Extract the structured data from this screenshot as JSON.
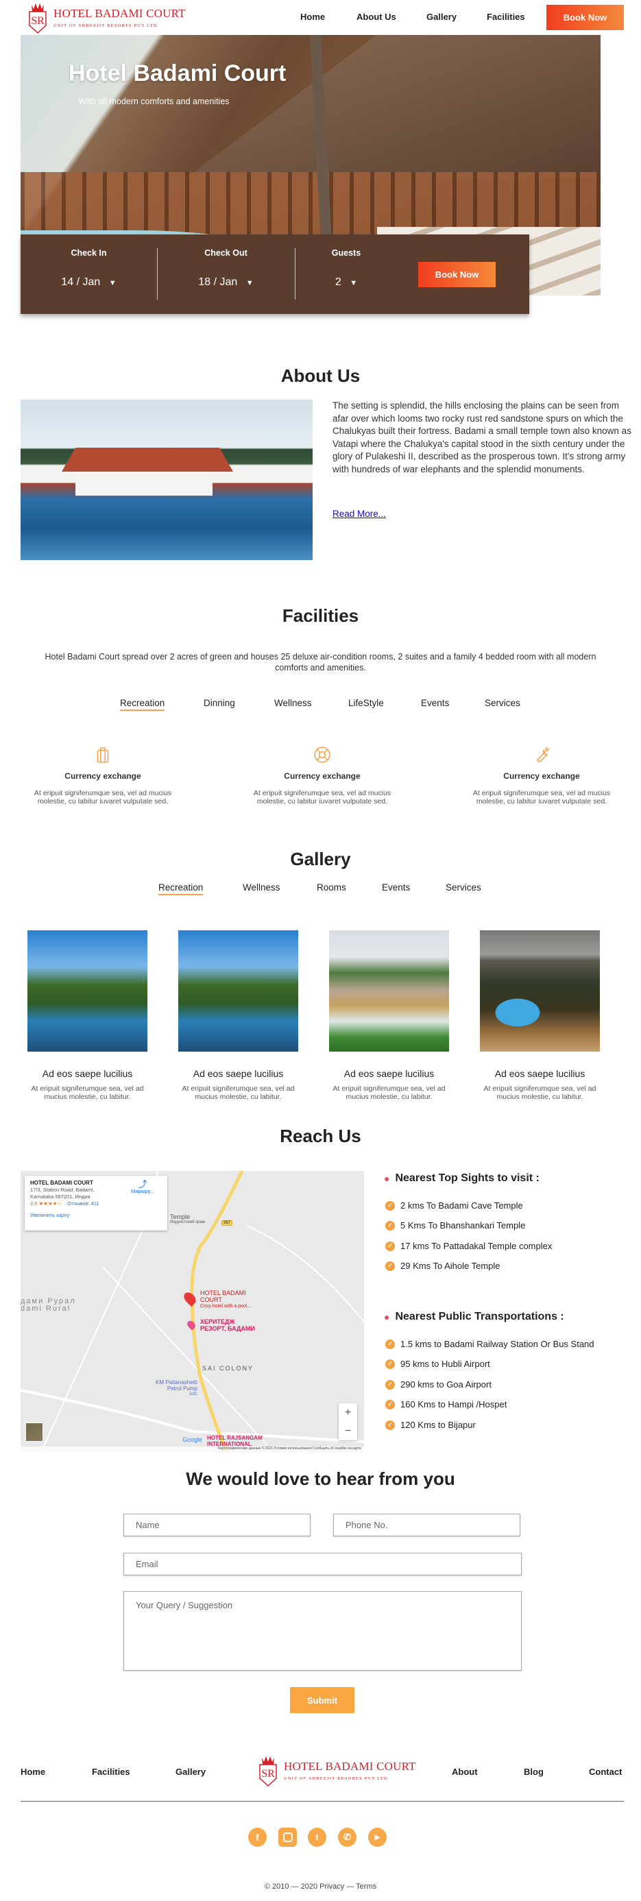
{
  "header": {
    "logo_title": "HOTEL BADAMI COURT",
    "logo_subtitle": "UNIT  OF SHREEJIT RESORTS PVT LTD",
    "nav": [
      "Home",
      "About Us",
      "Gallery",
      "Facilities"
    ],
    "book_now": "Book Now"
  },
  "hero": {
    "title": "Hotel Badami Court",
    "subtitle": "With all modern comforts and amenities"
  },
  "booking": {
    "check_in_label": "Check In",
    "check_in_value": "14 / Jan",
    "check_out_label": "Check Out",
    "check_out_value": "18 / Jan",
    "guests_label": "Guests",
    "guests_value": "2",
    "book_now": "Book Now"
  },
  "about": {
    "title": "About Us",
    "text": "The setting is splendid, the hills enclosing the plains can be seen from afar over which looms two rocky rust red sandstone spurs on which the Chalukyas built their fortress. Badami a small temple town also known as Vatapi where the Chalukya's capital stood in the sixth century under the glory of Pulakeshi II, described as the prosperous town. It's strong army with hundreds of war elephants and the splendid monuments.",
    "read_more": "Read More..."
  },
  "facilities": {
    "title": "Facilities",
    "description": "Hotel Badami Court spread over 2 acres of green and houses 25 deluxe air-condition rooms, 2 suites and a family 4 bedded room with all modern comforts and amenities.",
    "tabs": [
      "Recreation",
      "Dinning",
      "Wellness",
      "LifeStyle",
      "Events",
      "Services"
    ],
    "active_tab": "Recreation",
    "items": [
      {
        "icon": "briefcase-icon",
        "title": "Currency exchange",
        "text": "At eripuit signiferumque sea, vel ad mucius molestie, cu labitur iuvaret vulputate sed."
      },
      {
        "icon": "lifebuoy-icon",
        "title": "Currency exchange",
        "text": "At eripuit signiferumque sea, vel ad mucius molestie, cu labitur iuvaret vulputate sed."
      },
      {
        "icon": "wrench-icon",
        "title": "Currency exchange",
        "text": "At eripuit signiferumque sea, vel ad mucius molestie, cu labitur iuvaret vulputate sed."
      }
    ]
  },
  "gallery": {
    "title": "Gallery",
    "tabs": [
      "Recreation",
      "Wellness",
      "Rooms",
      "Events",
      "Services"
    ],
    "active_tab": "Recreation",
    "items": [
      {
        "title": "Ad eos saepe lucilius",
        "text": "At eripuit signiferumque sea, vel ad mucius molestie, cu labitur."
      },
      {
        "title": "Ad eos saepe lucilius",
        "text": "At eripuit signiferumque sea, vel ad mucius molestie, cu labitur."
      },
      {
        "title": "Ad eos saepe lucilius",
        "text": "At eripuit signiferumque sea, vel ad mucius molestie, cu labitur."
      },
      {
        "title": "Ad eos saepe lucilius",
        "text": "At eripuit signiferumque sea, vel ad mucius molestie, cu labitur."
      }
    ]
  },
  "reach": {
    "title": "Reach Us",
    "map": {
      "card_title": "HOTEL BADAMI COURT",
      "card_address_1": "17/3, Station Road, Badami,",
      "card_address_2": "Karnataka 587201, Индия",
      "rating": "3,6",
      "stars": "★★★★☆",
      "reviews": "Отзывов: 411",
      "enlarge": "Увеличить карту",
      "directions": "Маршру...",
      "pin_label_1": "HOTEL BADAMI",
      "pin_label_2": "COURT",
      "pin_desc": "Cosy hotel with a pool...",
      "heritage_1": "ХЕРИТЕДЖ",
      "heritage_2": "РЕЗОРТ, БАДАМИ",
      "temple": "Temple",
      "temple_sub": "Индуистский храм",
      "road_no": "367",
      "area_ru": "дами Рурал",
      "area_en": "dami Rural",
      "colony": "SAI COLONY",
      "petrol_1": "KM Pattanashetti",
      "petrol_2": "Petrol Pump",
      "petrol_3": "АЗС",
      "rajsangam_1": "HOTEL RAJSANGAM",
      "rajsangam_2": "INTERNATIONAL",
      "google": "Google",
      "attribution": "Картографические данные © 2021   Условия использования   Сообщить об ошибке на карте",
      "zoom_in": "+",
      "zoom_out": "−"
    },
    "sights_title": "Nearest Top Sights to visit :",
    "sights": [
      "2 kms To Badami Cave Temple",
      "5 Kms To Bhanshankari Temple",
      "17 kms To Pattadakal Temple complex",
      "29 Kms To Aihole Temple"
    ],
    "transport_title": "Nearest Public Transportations :",
    "transport": [
      "1.5 kms to Badami Railway Station Or Bus Stand",
      "95 kms to Hubli Airport",
      "290 kms to Goa Airport",
      "160 Kms to Hampi /Hospet",
      "120 Kms to Bijapur"
    ]
  },
  "contact": {
    "title": "We would love to hear from you",
    "name_placeholder": "Name",
    "phone_placeholder": "Phone No.",
    "email_placeholder": "Email",
    "query_placeholder": "Your Query / Suggestion",
    "submit": "Submit"
  },
  "footer": {
    "nav_left": [
      "Home",
      "Facilities",
      "Gallery"
    ],
    "nav_right": [
      "About",
      "Blog",
      "Contact"
    ],
    "social": [
      "facebook-icon",
      "instagram-icon",
      "twitter-icon",
      "whatsapp-icon",
      "youtube-icon"
    ],
    "copyright": "© 2010 — 2020 Privacy — Terms"
  },
  "colors": {
    "accent": "#f7a440",
    "brand_red": "#d61f26",
    "booking_bar": "#5b3d2e",
    "cta_start": "#f03d1e",
    "cta_end": "#f58a3c"
  }
}
